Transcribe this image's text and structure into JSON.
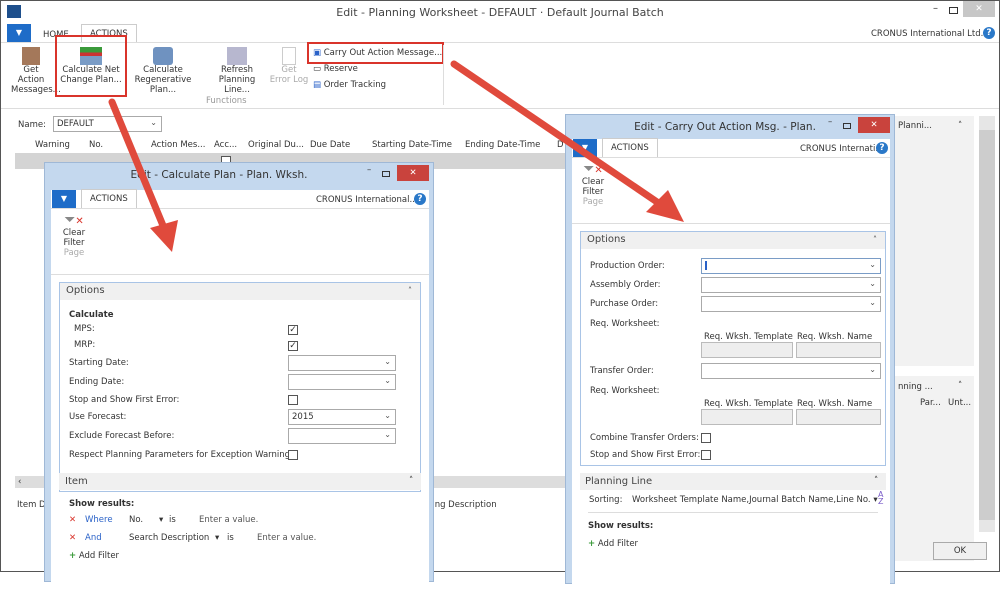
{
  "main": {
    "title": "Edit - Planning Worksheet - DEFAULT · Default Journal Batch",
    "tabs": [
      "HOME",
      "ACTIONS"
    ],
    "company": "CRONUS International Ltd.",
    "ribbon": {
      "buttons": [
        {
          "label1": "Get Action",
          "label2": "Messages..."
        },
        {
          "label1": "Calculate Net",
          "label2": "Change Plan..."
        },
        {
          "label1": "Calculate",
          "label2": "Regenerative Plan..."
        },
        {
          "label1": "Refresh",
          "label2": "Planning Line..."
        },
        {
          "label1": "Get",
          "label2": "Error Log"
        }
      ],
      "small": [
        "Carry Out Action Message...",
        "Reserve",
        "Order Tracking"
      ],
      "group": "Functions"
    },
    "name_label": "Name:",
    "name_value": "DEFAULT",
    "columns": [
      "Warning",
      "No.",
      "Action Mes...",
      "Acc...",
      "Original Du...",
      "Due Date",
      "Starting Date-Time",
      "Ending Date-Time",
      "D"
    ],
    "bottom_left": "Item De",
    "bottom_mid": "ting Description",
    "factbox1": "Planni...",
    "factbox2": "nning ...",
    "factbox2_cols": [
      "Par...",
      "Unt..."
    ],
    "ok": "OK"
  },
  "calc_dialog": {
    "title": "Edit - Calculate Plan - Plan. Wksh.",
    "tab": "ACTIONS",
    "company": "CRONUS International...",
    "clear_filter": [
      "Clear",
      "Filter"
    ],
    "page": "Page",
    "options": "Options",
    "calculate": "Calculate",
    "mps": "MPS:",
    "mrp": "MRP:",
    "starting_date": "Starting Date:",
    "ending_date": "Ending Date:",
    "stop": "Stop and Show First Error:",
    "use_forecast": "Use Forecast:",
    "use_forecast_value": "2015",
    "exclude": "Exclude Forecast Before:",
    "respect": "Respect Planning Parameters for Exception Warnings:",
    "item": "Item",
    "show_results": "Show results:",
    "filters": [
      {
        "op": "Where",
        "field": "No.",
        "is": "is",
        "value": "Enter a value."
      },
      {
        "op": "And",
        "field": "Search Description",
        "is": "is",
        "value": "Enter a value."
      }
    ],
    "add_filter": "Add Filter"
  },
  "carry_dialog": {
    "title": "Edit - Carry Out Action Msg. - Plan.",
    "tab": "ACTIONS",
    "company": "CRONUS Internati...",
    "clear_filter": [
      "Clear",
      "Filter"
    ],
    "page": "Page",
    "options": "Options",
    "production": "Production Order:",
    "assembly": "Assembly Order:",
    "purchase": "Purchase Order:",
    "req_ws": "Req. Worksheet:",
    "req_template": "Req. Wksh. Template",
    "req_name": "Req. Wksh. Name",
    "transfer": "Transfer Order:",
    "combine": "Combine Transfer Orders:",
    "stop": "Stop and Show First Error:",
    "planning_line": "Planning Line",
    "sorting_label": "Sorting:",
    "sorting_value": "Worksheet Template Name,Journal Batch Name,Line No.",
    "show_results": "Show results:",
    "add_filter": "Add Filter"
  },
  "colors": {
    "accent": "#1e6cc8",
    "highlight": "#d9342b",
    "dialog_frame": "#c4d8ee"
  }
}
